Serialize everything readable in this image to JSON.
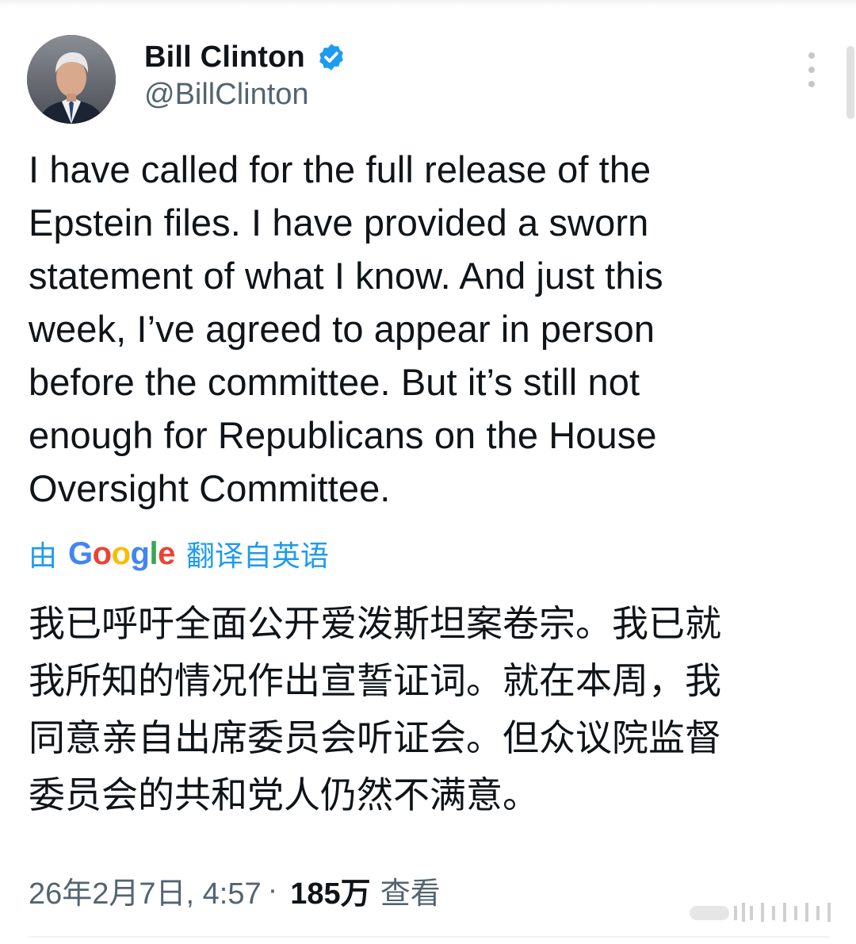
{
  "tweet": {
    "author": {
      "display_name": "Bill Clinton",
      "handle": "@BillClinton",
      "verified": true
    },
    "text": "I have called for the full release of the\nEpstein files. I have provided a sworn\nstatement of what I know. And just this\nweek, I’ve agreed to appear in person\nbefore the committee. But it’s still not\nenough for Republicans on the House\nOversight Committee.",
    "translation": {
      "prefix": "由",
      "provider": "Google",
      "suffix": "翻译自英语",
      "text": "我已呼吁全面公开爱泼斯坦案卷宗。我已就\n我所知的情况作出宣誓证词。就在本周，我\n同意亲自出席委员会听证会。但众议院监督\n委员会的共和党人仍然不满意。"
    },
    "meta": {
      "timestamp": "26年2月7日, 4:57",
      "separator": "·",
      "views_count": "185万",
      "views_label": "查看"
    }
  },
  "icons": {
    "verified": "verified-badge-icon",
    "more": "more-options-icon"
  },
  "colors": {
    "text_primary": "#0f1419",
    "text_secondary": "#536471",
    "accent": "#1d9bf0"
  }
}
